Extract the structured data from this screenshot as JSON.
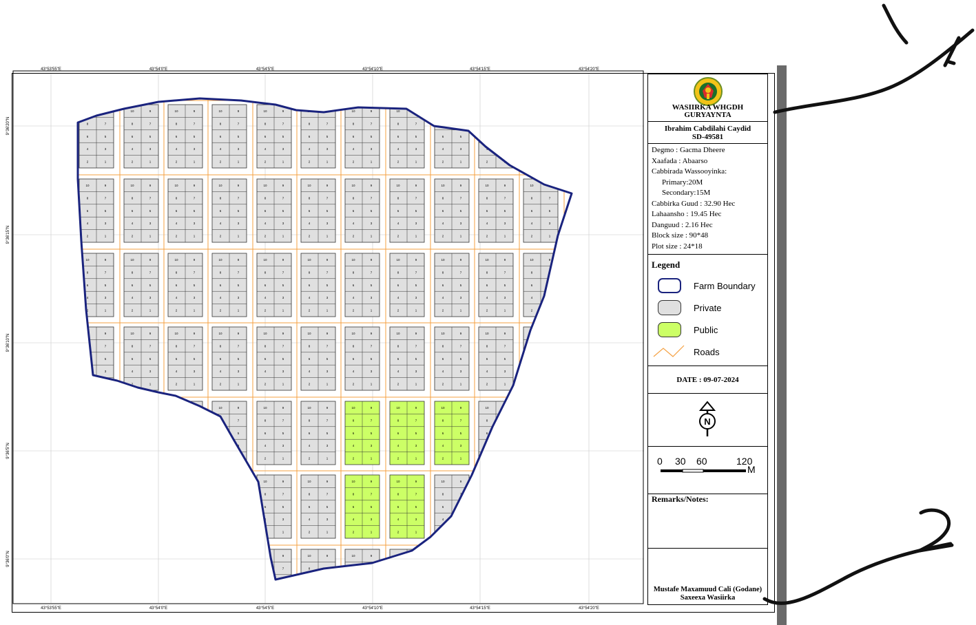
{
  "map": {
    "coord_top": [
      "43°53'55\"E",
      "43°54'0\"E",
      "43°54'5\"E",
      "43°54'10\"E",
      "43°54'15\"E",
      "43°54'20\"E"
    ],
    "coord_bottom": [
      "43°53'55\"E",
      "43°54'0\"E",
      "43°54'5\"E",
      "43°54'10\"E",
      "43°54'15\"E",
      "43°54'20\"E"
    ],
    "coord_left": [
      "9°36'20\"N",
      "9°36'15\"N",
      "9°36'10\"N",
      "9°36'5\"N",
      "9°36'0\"N"
    ],
    "colors": {
      "boundary": "#1a237e",
      "private": "#e0e0e0",
      "public": "#ccff66",
      "roads": "#f5a142",
      "parcel_label": "#e53935"
    }
  },
  "panel": {
    "ministry": "WASIIRKA WHGDH GURYAYNTA",
    "owner_name": "Ibrahim Cabdilahi Caydid",
    "owner_id": "SD-49581",
    "info": {
      "degmo": "Degmo : Gacma Dheere",
      "xaafada": "Xaafada : Abaarso",
      "cabbirada": "Cabbirada Wassooyinka:",
      "primary": "Primary:20M",
      "secondary": "Secondary:15M",
      "cabbirka_guud": "Cabbirka Guud : 32.90 Hec",
      "lahaansho": "Lahaansho : 19.45 Hec",
      "danguud": "Danguud : 2.16 Hec",
      "block_size": "Block size : 90*48",
      "plot_size": "Plot size : 24*18"
    },
    "legend": {
      "title": "Legend",
      "items": [
        {
          "label": "Farm Boundary",
          "icon": "boundary-swatch"
        },
        {
          "label": "Private",
          "icon": "private-swatch"
        },
        {
          "label": "Public",
          "icon": "public-swatch"
        },
        {
          "label": "Roads",
          "icon": "roads-swatch"
        }
      ]
    },
    "date": "DATE : 09-07-2024",
    "north_letter": "N",
    "scale": {
      "labels": [
        "0",
        "30",
        "60",
        "120"
      ],
      "unit": "M"
    },
    "remarks": "Remarks/Notes:",
    "signatory": "Mustafe Maxamuud Cali (Godane)",
    "signatory_title": "Saxeexa Wasiirka"
  },
  "annotations": {
    "one": "1",
    "two": "2"
  }
}
